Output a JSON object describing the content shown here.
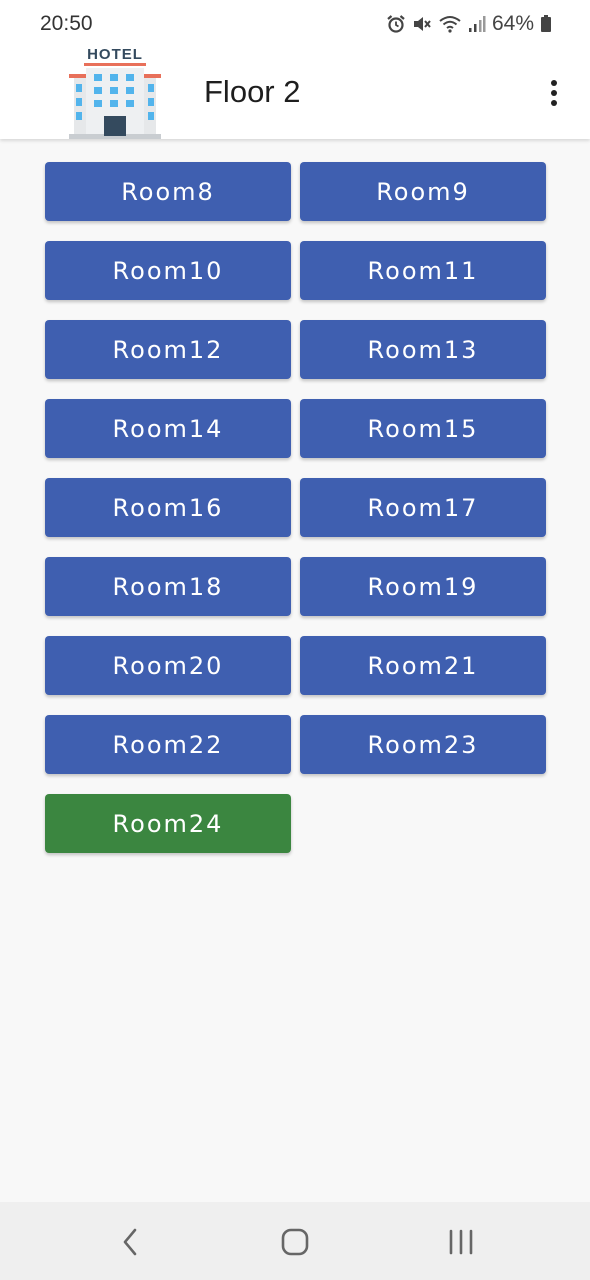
{
  "status_bar": {
    "time": "20:50",
    "battery": "64%",
    "icons": [
      "alarm-icon",
      "mute-icon",
      "wifi-icon",
      "signal-icon",
      "battery-icon"
    ]
  },
  "app_bar": {
    "logo_text": "HOTEL",
    "title": "Floor 2",
    "menu_icon": "overflow-menu-icon"
  },
  "rooms": [
    {
      "label": "Room8",
      "active": false
    },
    {
      "label": "Room9",
      "active": false
    },
    {
      "label": "Room10",
      "active": false
    },
    {
      "label": "Room11",
      "active": false
    },
    {
      "label": "Room12",
      "active": false
    },
    {
      "label": "Room13",
      "active": false
    },
    {
      "label": "Room14",
      "active": false
    },
    {
      "label": "Room15",
      "active": false
    },
    {
      "label": "Room16",
      "active": false
    },
    {
      "label": "Room17",
      "active": false
    },
    {
      "label": "Room18",
      "active": false
    },
    {
      "label": "Room19",
      "active": false
    },
    {
      "label": "Room20",
      "active": false
    },
    {
      "label": "Room21",
      "active": false
    },
    {
      "label": "Room22",
      "active": false
    },
    {
      "label": "Room23",
      "active": false
    },
    {
      "label": "Room24",
      "active": true
    }
  ],
  "colors": {
    "room_default": "#3f5fb0",
    "room_active": "#3b8640",
    "background": "#f8f8f8"
  },
  "nav_bar": {
    "icons": [
      "back-icon",
      "home-icon",
      "recents-icon"
    ]
  }
}
